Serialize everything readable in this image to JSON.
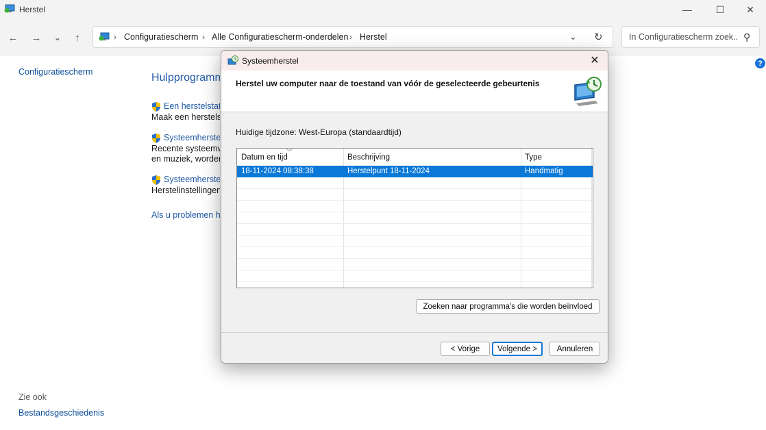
{
  "window": {
    "title": "Herstel"
  },
  "window_controls": {
    "minimize": "—",
    "maximize": "☐",
    "close": "✕"
  },
  "nav": {
    "back": "←",
    "forward": "→",
    "recent": "⌄",
    "up": "↑"
  },
  "breadcrumbs": [
    {
      "label": "Configuratiescherm"
    },
    {
      "label": "Alle Configuratiescherm-onderdelen"
    },
    {
      "label": "Herstel"
    }
  ],
  "breadcrumb_separator": "›",
  "search": {
    "placeholder": "In Configuratiescherm zoek..."
  },
  "left_pane": {
    "home_link": "Configuratiescherm",
    "see_also_label": "Zie ook",
    "see_also_link": "Bestandsgeschiedenis"
  },
  "main": {
    "title": "Hulpprogramma's voor geavanceerd herstel",
    "tools": [
      {
        "link": "Een herstelstation maken",
        "desc": [
          "Maak een herstelstation"
        ]
      },
      {
        "link": "Systeemherstel openen",
        "desc": [
          "Recente systeemwijzigingen ongedaan maken",
          "en muziek, worden"
        ]
      },
      {
        "link": "Systeemherstel configureren",
        "desc": [
          "Herstelinstellingen wijzigen"
        ]
      }
    ],
    "problem_link": "Als u problemen hebt"
  },
  "dialog": {
    "title": "Systeemherstel",
    "heading": "Herstel uw computer naar de toestand van vóór de geselecteerde gebeurtenis",
    "timezone": "Huidige tijdzone: West-Europa (standaardtijd)",
    "columns": [
      "Datum en tijd",
      "Beschrijving",
      "Type"
    ],
    "rows": [
      {
        "datetime": "18-11-2024 08:38:38",
        "description": "Herstelpunt 18-11-2024",
        "type": "Handmatig"
      }
    ],
    "scan_button": "Zoeken naar programma's die worden beïnvloed",
    "back_button": "< Vorige",
    "next_button": "Volgende >",
    "cancel_button": "Annuleren"
  },
  "colors": {
    "accent": "#0a78d7",
    "link": "#1f5aa5",
    "dialog_titlebar": "#f9ecec"
  }
}
